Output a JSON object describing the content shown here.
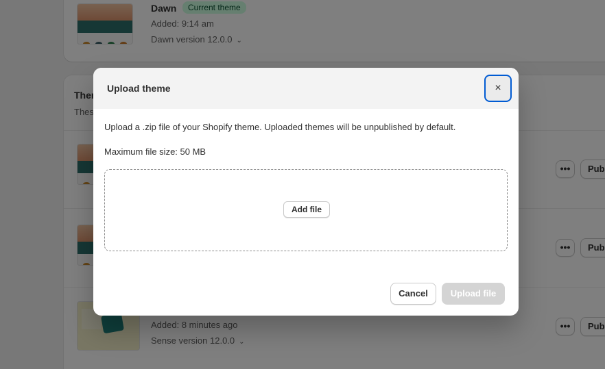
{
  "current_theme": {
    "name": "Dawn",
    "badge": "Current theme",
    "added": "Added: 9:14 am",
    "version": "Dawn version 12.0.0"
  },
  "library": {
    "title_partial": "Ther",
    "subtitle_partial": "Thes",
    "rows": [
      {
        "more_label": "•••",
        "publish_label": "Publish"
      },
      {
        "more_label": "•••",
        "publish_label": "Publish"
      },
      {
        "added": "Added: 8 minutes ago",
        "version": "Sense version 12.0.0",
        "more_label": "•••",
        "publish_label": "Publish"
      }
    ]
  },
  "modal": {
    "title": "Upload theme",
    "close_glyph": "×",
    "description": "Upload a .zip file of your Shopify theme. Uploaded themes will be unpublished by default.",
    "max_size": "Maximum file size: 50 MB",
    "add_file_label": "Add file",
    "cancel_label": "Cancel",
    "upload_label": "Upload file"
  },
  "icons": {
    "chevron": "chevron-down-icon",
    "close": "close-icon",
    "more": "ellipsis-icon"
  },
  "colors": {
    "focus_ring": "#005bd3",
    "badge_bg": "#cdfee1",
    "badge_text": "#0c5132",
    "disabled_primary": "#d4d4d4"
  }
}
